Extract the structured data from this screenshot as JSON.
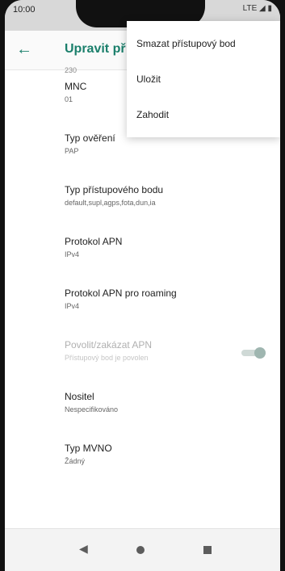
{
  "status_bar": {
    "time": "10:00",
    "network": "LTE ◢ ▮"
  },
  "app_bar": {
    "title": "Upravit př"
  },
  "partial_top_value": "230",
  "settings": [
    {
      "label": "MNC",
      "value": "01"
    },
    {
      "label": "Typ ověření",
      "value": "PAP"
    },
    {
      "label": "Typ přístupového bodu",
      "value": "default,supl,agps,fota,dun,ia"
    },
    {
      "label": "Protokol APN",
      "value": "IPv4"
    },
    {
      "label": "Protokol APN pro roaming",
      "value": "IPv4"
    },
    {
      "label": "Povolit/zakázat APN",
      "value": "Přístupový bod je povolen",
      "enabled": false,
      "toggle_on": true
    },
    {
      "label": "Nositel",
      "value": "Nespecifikováno"
    },
    {
      "label": "Typ MVNO",
      "value": "Žádný"
    }
  ],
  "overflow_menu": {
    "items": [
      "Smazat přístupový bod",
      "Uložit",
      "Zahodit"
    ]
  },
  "nav_bar": {
    "back": "◀",
    "home": "●",
    "recents": "■"
  }
}
